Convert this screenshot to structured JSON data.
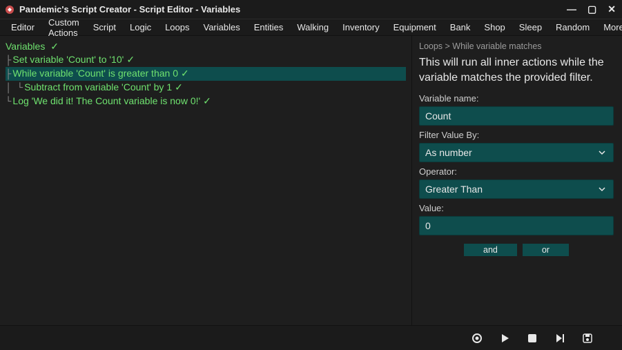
{
  "title": "Pandemic's Script Creator - Script Editor - Variables",
  "menus": [
    "Editor",
    "Custom Actions",
    "Script",
    "Logic",
    "Loops",
    "Variables",
    "Entities",
    "Walking",
    "Inventory",
    "Equipment",
    "Bank",
    "Shop",
    "Sleep",
    "Random",
    "More"
  ],
  "tree": {
    "header": "Variables",
    "lines": [
      {
        "prefix": "├ ",
        "text": "Set variable 'Count' to '10'",
        "sel": false
      },
      {
        "prefix": "├ ",
        "text": "While variable 'Count' is greater than 0",
        "sel": true
      },
      {
        "prefix": "│  └ ",
        "text": "Subtract from variable 'Count' by 1",
        "sel": false
      },
      {
        "prefix": "└ ",
        "text": "Log 'We did it! The Count variable is now 0!'",
        "sel": false
      }
    ]
  },
  "panel": {
    "breadcrumb": "Loops > While variable matches",
    "description": "This will run all inner actions while the variable matches the provided filter.",
    "variable_label": "Variable name:",
    "variable_value": "Count",
    "filter_label": "Filter Value By:",
    "filter_value": "As number",
    "operator_label": "Operator:",
    "operator_value": "Greater Than",
    "value_label": "Value:",
    "value_value": "0",
    "and_label": "and",
    "or_label": "or"
  }
}
